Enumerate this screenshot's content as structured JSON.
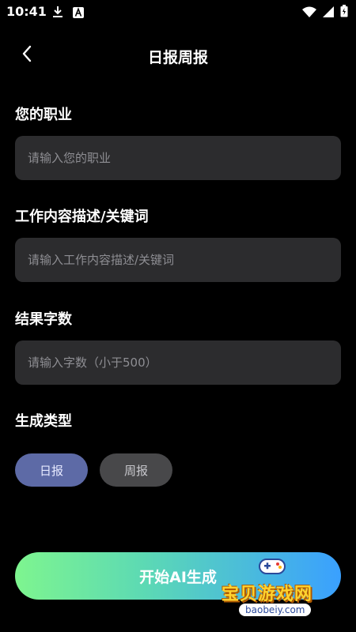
{
  "status_bar": {
    "time": "10:41",
    "icons_left": [
      "download-icon",
      "a-letter-icon"
    ],
    "icons_right": [
      "wifi-icon",
      "signal-icon",
      "battery-icon"
    ]
  },
  "header": {
    "title": "日报周报",
    "back_icon": "chevron-left-icon"
  },
  "form": {
    "occupation": {
      "label": "您的职业",
      "placeholder": "请输入您的职业",
      "value": ""
    },
    "description": {
      "label": "工作内容描述/关键词",
      "placeholder": "请输入工作内容描述/关键词",
      "value": ""
    },
    "word_count": {
      "label": "结果字数",
      "placeholder": "请输入字数（小于500）",
      "value": ""
    },
    "type": {
      "label": "生成类型",
      "options": [
        {
          "label": "日报",
          "selected": true
        },
        {
          "label": "周报",
          "selected": false
        }
      ]
    }
  },
  "start_button": {
    "label": "开始AI生成"
  },
  "watermark": {
    "text": "宝贝游戏网",
    "url": "baobeiy.com"
  },
  "colors": {
    "background": "#000000",
    "input_bg": "#2c2c2e",
    "chip_selected": "#5d6aa6",
    "chip_unselected": "#48484a",
    "gradient_start": "#7ef58f",
    "gradient_end": "#3aa0ff"
  }
}
